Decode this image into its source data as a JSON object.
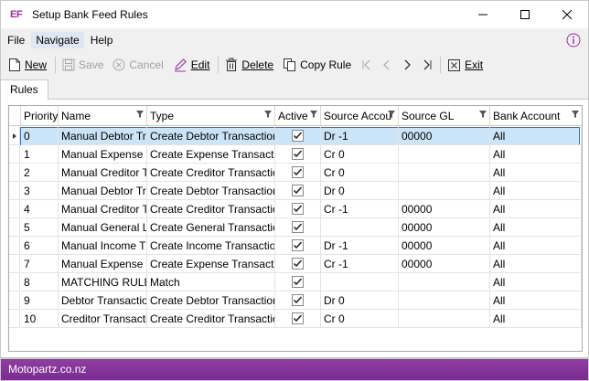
{
  "window": {
    "logo": "EF",
    "title": "Setup Bank Feed Rules",
    "accent": "#9b2c9f"
  },
  "menu": {
    "file": "File",
    "navigate": "Navigate",
    "help": "Help"
  },
  "toolbar": {
    "new": "New",
    "save": "Save",
    "cancel": "Cancel",
    "edit": "Edit",
    "delete": "Delete",
    "copy_rule": "Copy Rule",
    "exit": "Exit"
  },
  "tabs": {
    "rules": "Rules"
  },
  "grid": {
    "columns": {
      "priority": "Priority",
      "name": "Name",
      "type": "Type",
      "active": "Active",
      "source_account": "Source Accou",
      "source_gl": "Source GL",
      "bank_account": "Bank Account"
    },
    "rows": [
      {
        "priority": "0",
        "name": "Manual Debtor Tr",
        "type": "Create Debtor Transaction",
        "active": true,
        "source_account": "Dr -1",
        "source_gl": "00000",
        "bank_account": "All"
      },
      {
        "priority": "1",
        "name": "Manual Expense T",
        "type": "Create Expense Transactio",
        "active": true,
        "source_account": "Cr 0",
        "source_gl": "",
        "bank_account": "All"
      },
      {
        "priority": "2",
        "name": "Manual Creditor T",
        "type": "Create Creditor Transactio",
        "active": true,
        "source_account": "Cr 0",
        "source_gl": "",
        "bank_account": "All"
      },
      {
        "priority": "3",
        "name": "Manual Debtor Tr",
        "type": "Create Debtor Transaction",
        "active": true,
        "source_account": "Dr 0",
        "source_gl": "",
        "bank_account": "All"
      },
      {
        "priority": "4",
        "name": "Manual Creditor T",
        "type": "Create Creditor Transactio",
        "active": true,
        "source_account": "Cr -1",
        "source_gl": "00000",
        "bank_account": "All"
      },
      {
        "priority": "5",
        "name": "Manual General L",
        "type": "Create General Transaction",
        "active": true,
        "source_account": "",
        "source_gl": "00000",
        "bank_account": "All"
      },
      {
        "priority": "6",
        "name": "Manual Income T",
        "type": "Create Income Transactio",
        "active": true,
        "source_account": "Dr -1",
        "source_gl": "00000",
        "bank_account": "All"
      },
      {
        "priority": "7",
        "name": "Manual Expense T",
        "type": "Create Expense Transactio",
        "active": true,
        "source_account": "Cr -1",
        "source_gl": "00000",
        "bank_account": "All"
      },
      {
        "priority": "8",
        "name": "MATCHING RULE",
        "type": "Match",
        "active": true,
        "source_account": "",
        "source_gl": "",
        "bank_account": "All"
      },
      {
        "priority": "9",
        "name": "Debtor Transactio",
        "type": "Create Debtor Transaction",
        "active": true,
        "source_account": "Dr 0",
        "source_gl": "",
        "bank_account": "All"
      },
      {
        "priority": "10",
        "name": "Creditor Transacti",
        "type": "Create Creditor Transactio",
        "active": true,
        "source_account": "Cr 0",
        "source_gl": "",
        "bank_account": "All"
      }
    ]
  },
  "status": {
    "company": "Motopartz.co.nz"
  }
}
